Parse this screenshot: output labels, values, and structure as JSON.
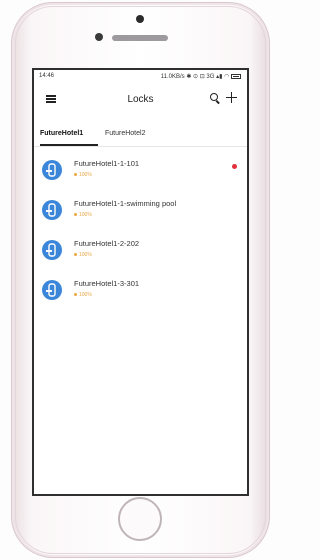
{
  "status_bar": {
    "time": "14:46",
    "indicators": "11.0KB/s ✱ ⊙ ⊡ 3G ▴▮ ◠",
    "battery_icon": "battery-icon"
  },
  "app_bar": {
    "title": "Locks",
    "menu_icon": "menu-icon",
    "search_icon": "search-icon",
    "add_icon": "plus-icon"
  },
  "tabs": [
    {
      "label": "FutureHotel1",
      "active": true
    },
    {
      "label": "FutureHotel2",
      "active": false
    }
  ],
  "locks": [
    {
      "name": "FutureHotel1-1-101",
      "battery": "100%",
      "alert": true
    },
    {
      "name": "FutureHotel1-1-swimming pool",
      "battery": "100%",
      "alert": false
    },
    {
      "name": "FutureHotel1-2-202",
      "battery": "100%",
      "alert": false
    },
    {
      "name": "FutureHotel1-3-301",
      "battery": "100%",
      "alert": false
    }
  ],
  "colors": {
    "accent": "#3b86d8",
    "battery": "#e9a740",
    "alert": "#e0303a"
  }
}
